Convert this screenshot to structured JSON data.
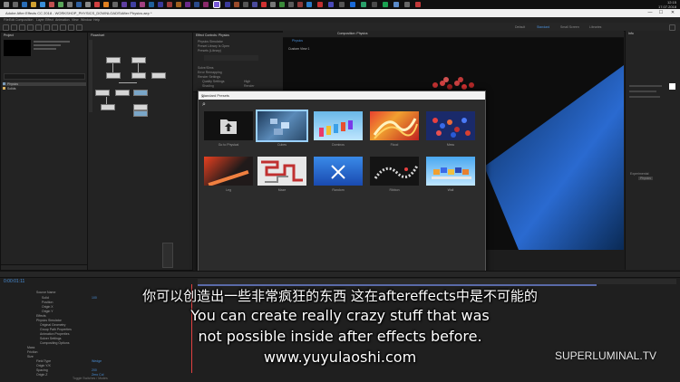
{
  "window": {
    "title": "Adobe After Effects CC 2018 - WORKSHOP_PHYSICS_DOWNLOADS\\After Physics.aep *",
    "minimize": "—",
    "maximize": "☐",
    "close": "✕"
  },
  "taskbar": {
    "clock": "12:15",
    "date": "17.07.2018"
  },
  "menu": [
    "File",
    "Edit",
    "Composition",
    "Layer",
    "Effect",
    "Animation",
    "View",
    "Window",
    "Help"
  ],
  "workspaces": [
    "Default",
    "Standard",
    "Small Screen",
    "Libraries"
  ],
  "project_panel": {
    "tab": "Project",
    "items": [
      {
        "name": "Physics"
      },
      {
        "name": "Solids"
      }
    ]
  },
  "flowchart_tab": "Flowchart",
  "effect_controls": {
    "tab": "Effect Controls: Physics",
    "rows": [
      "Physics Simulator",
      "Preset Library Is Open",
      "Presets (Library)",
      "Solve/Sims",
      "Error Remapping",
      "Render Settings",
      "Quality Settings",
      "Shading"
    ],
    "values": [
      "High",
      "Render"
    ]
  },
  "composition": {
    "tab": "Composition: Physics",
    "sub_tab": "Physics",
    "label": "Custom View 1"
  },
  "presets_dialog": {
    "title": "Standard Presets",
    "close": "✕",
    "search_icon": "search-icon",
    "items": [
      {
        "label": "Go to Physical",
        "kind": "folder"
      },
      {
        "label": "Cubes",
        "kind": "cubes"
      },
      {
        "label": "Dominos",
        "kind": "dominos"
      },
      {
        "label": "Flood",
        "kind": "flood"
      },
      {
        "label": "Mess",
        "kind": "mess"
      },
      {
        "label": "Leg",
        "kind": "leg"
      },
      {
        "label": "Maze",
        "kind": "maze"
      },
      {
        "label": "Random",
        "kind": "random"
      },
      {
        "label": "Ribbon",
        "kind": "ribbon"
      },
      {
        "label": "Wall",
        "kind": "wall"
      }
    ]
  },
  "right_panel": {
    "tab": "Info",
    "section": "Experimental",
    "value": "Physics"
  },
  "timeline": {
    "timecode": "0:00:01:11",
    "layers": [
      "Source Name",
      "Solid",
      "Position",
      "Origin X",
      "Origin Y",
      "Effects",
      "Physics Simulator",
      "Original Geometry",
      "Group Path Properties",
      "Animation Properties",
      "Solver Settings",
      "Compositing Options",
      "Mass",
      "Friction",
      "Size",
      "Field Type",
      "Origin Y/X",
      "Spacing",
      "Origin Z",
      "Animate",
      "Wheel"
    ],
    "values": [
      "100",
      "Wedge",
      "200",
      "Zero Col"
    ],
    "footer": "Toggle Switches / Modes"
  },
  "subtitles": {
    "chinese": "你可以创造出一些非常疯狂的东西 这在aftereffects中是不可能的",
    "line1": "You can create really crazy stuff that was",
    "line2": "not possible inside after effects before.",
    "url": "www.yuyulaoshi.com"
  },
  "watermark": "SUPERLUMINAL.TV"
}
